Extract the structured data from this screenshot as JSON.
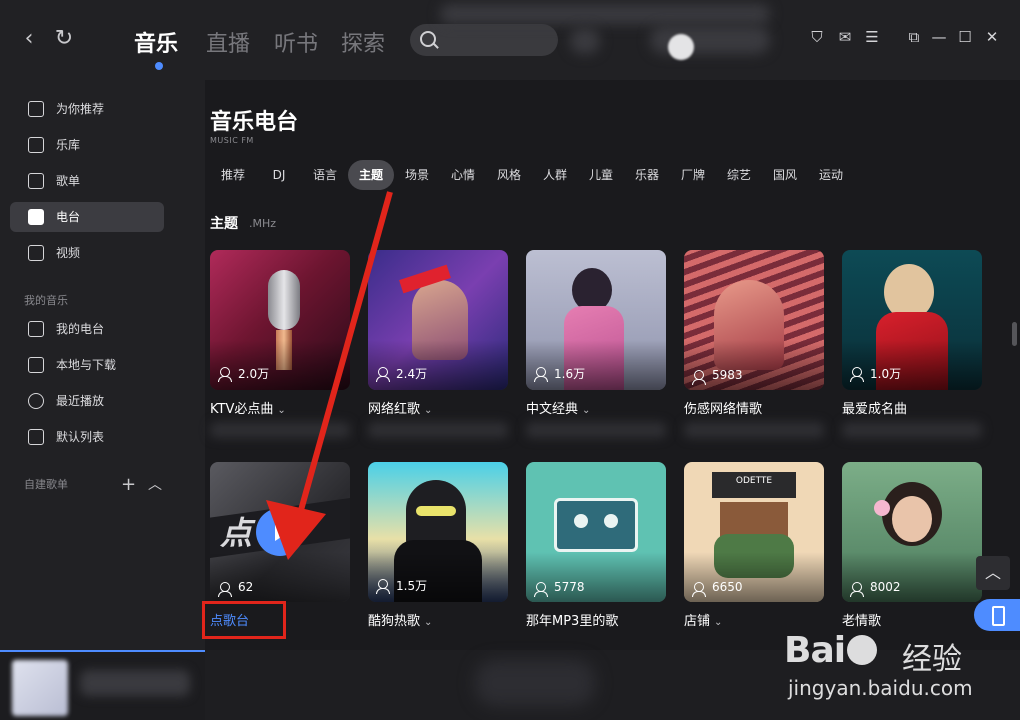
{
  "header": {
    "tabs": [
      {
        "label": "音乐",
        "active": true
      },
      {
        "label": "直播",
        "active": false
      },
      {
        "label": "听书",
        "active": false
      },
      {
        "label": "探索",
        "active": false
      }
    ],
    "icons": [
      "back-icon",
      "refresh-icon",
      "search-icon",
      "skin-icon",
      "mail-icon",
      "menu-icon",
      "mini-mode-icon",
      "minimize-icon",
      "maximize-icon",
      "close-icon"
    ],
    "accent_color": "#4e8cff"
  },
  "sidebar": {
    "items": [
      {
        "label": "为你推荐",
        "icon": "star-icon",
        "active": false
      },
      {
        "label": "乐库",
        "icon": "music-note-icon",
        "active": false
      },
      {
        "label": "歌单",
        "icon": "playlist-icon",
        "active": false
      },
      {
        "label": "电台",
        "icon": "radio-icon",
        "active": true
      },
      {
        "label": "视频",
        "icon": "video-icon",
        "active": false
      }
    ],
    "my_music_heading": "我的音乐",
    "my_music_items": [
      {
        "label": "我的电台",
        "icon": "radio-icon"
      },
      {
        "label": "本地与下载",
        "icon": "download-icon"
      },
      {
        "label": "最近播放",
        "icon": "clock-icon"
      },
      {
        "label": "默认列表",
        "icon": "list-icon"
      }
    ],
    "custom_heading": "自建歌单"
  },
  "main": {
    "title": "音乐电台",
    "subtitle": "MUSIC FM",
    "categories": [
      {
        "label": "推荐",
        "active": false
      },
      {
        "label": "DJ",
        "active": false
      },
      {
        "label": "语言",
        "active": false
      },
      {
        "label": "主题",
        "active": true
      },
      {
        "label": "场景",
        "active": false
      },
      {
        "label": "心情",
        "active": false
      },
      {
        "label": "风格",
        "active": false
      },
      {
        "label": "人群",
        "active": false
      },
      {
        "label": "儿童",
        "active": false
      },
      {
        "label": "乐器",
        "active": false
      },
      {
        "label": "厂牌",
        "active": false
      },
      {
        "label": "综艺",
        "active": false
      },
      {
        "label": "国风",
        "active": false
      },
      {
        "label": "运动",
        "active": false
      }
    ],
    "section_title": "主题",
    "section_unit": ".MHz",
    "cards": [
      {
        "name": "KTV必点曲",
        "count": "2.0万",
        "has_dropdown": true
      },
      {
        "name": "网络红歌",
        "count": "2.4万",
        "has_dropdown": true
      },
      {
        "name": "中文经典",
        "count": "1.6万",
        "has_dropdown": true
      },
      {
        "name": "伤感网络情歌",
        "count": "5983",
        "has_dropdown": false
      },
      {
        "name": "最爱成名曲",
        "count": "1.0万",
        "has_dropdown": false
      },
      {
        "name": "点歌台",
        "count": "62",
        "has_dropdown": false
      },
      {
        "name": "酷狗热歌",
        "count": "1.5万",
        "has_dropdown": true
      },
      {
        "name": "那年MP3里的歌",
        "count": "5778",
        "has_dropdown": false
      },
      {
        "name": "店铺",
        "count": "6650",
        "has_dropdown": true
      },
      {
        "name": "老情歌",
        "count": "8002",
        "has_dropdown": false
      }
    ]
  },
  "watermark": {
    "logo": "Bai",
    "logo_suffix": "经验",
    "url": "jingyan.baidu.com"
  }
}
